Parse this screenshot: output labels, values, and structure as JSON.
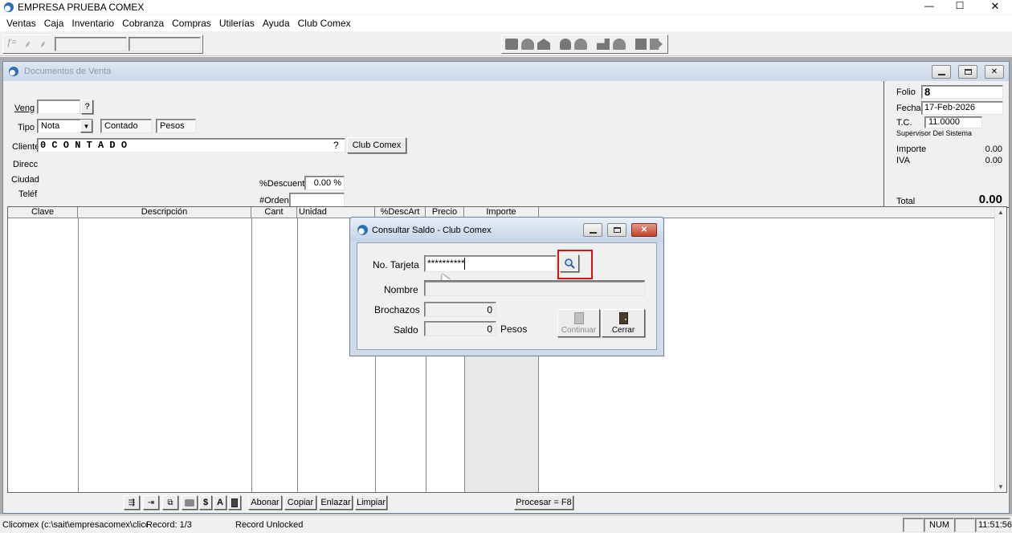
{
  "app": {
    "title": "EMPRESA PRUEBA COMEX",
    "controls": {
      "minimize": "—",
      "maximize": "☐",
      "close": "✕"
    }
  },
  "menu": [
    "Ventas",
    "Caja",
    "Inventario",
    "Cobranza",
    "Compras",
    "Utilerías",
    "Ayuda",
    "Club Comex"
  ],
  "mdi": {
    "title": "Documentos de Venta"
  },
  "form": {
    "veng_label": "Veng",
    "veng_value": "",
    "question": "?",
    "tipo_label": "Tipo",
    "tipo_value": "Nota",
    "contado": "Contado",
    "pesos": "Pesos",
    "cliente_label": "Cliente",
    "cliente_value": "0 C O N T A D O",
    "club_comex_button": "Club Comex",
    "direcc_label": "Direcc",
    "ciudad_label": "Ciudad",
    "telef_label": "Teléf",
    "descuento_label": "%Descuent",
    "descuento_value": "0.00 %",
    "orden_label": "#Orden",
    "orden_value": ""
  },
  "summary": {
    "folio_label": "Folio",
    "folio_value": "8",
    "fecha_label": "Fecha",
    "fecha_value": "17-Feb-2026",
    "tc_label": "T.C.",
    "tc_value": "11.0000",
    "user": "Supervisor Del Sistema",
    "importe_label": "Importe",
    "importe_value": "0.00",
    "iva_label": "IVA",
    "iva_value": "0.00",
    "total_label": "Total",
    "total_value": "0.00"
  },
  "grid": {
    "columns": [
      "Clave",
      "Descripción",
      "Cant",
      "Unidad",
      "%DescArt",
      "Precio",
      "Importe"
    ]
  },
  "bottom_toolbar": {
    "dollar": "$",
    "letter_a": "A",
    "abonar": "Abonar",
    "copiar": "Copiar",
    "enlazar": "Enlazar",
    "limpiar": "Limpiar",
    "procesar": "Procesar = F8"
  },
  "dialog": {
    "title": "Consultar Saldo - Club Comex",
    "tarjeta_label": "No. Tarjeta",
    "tarjeta_value": "**********",
    "nombre_label": "Nombre",
    "nombre_value": "",
    "brochazos_label": "Brochazos",
    "brochazos_value": "0",
    "saldo_label": "Saldo",
    "saldo_value": "0",
    "pesos_label": "Pesos",
    "continuar": "Continuar",
    "cerrar": "Cerrar",
    "highlight_color": "#e01010"
  },
  "statusbar": {
    "path": "Clicomex (c:\\sait\\empresacomex\\clicor",
    "record": "Record: 1/3",
    "lock": "Record Unlocked",
    "num": "NUM",
    "time": "11:51:56"
  }
}
